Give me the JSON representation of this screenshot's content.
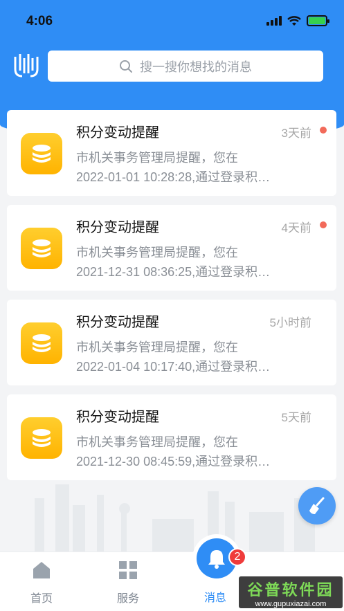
{
  "status_bar": {
    "time": "4:06"
  },
  "search": {
    "placeholder": "搜一搜你想找的消息"
  },
  "messages": [
    {
      "title": "积分变动提醒",
      "time": "3天前",
      "unread": true,
      "line1": "市机关事务管理局提醒，您在",
      "line2": "2022-01-01 10:28:28,通过登录积…"
    },
    {
      "title": "积分变动提醒",
      "time": "4天前",
      "unread": true,
      "line1": "市机关事务管理局提醒，您在",
      "line2": "2021-12-31 08:36:25,通过登录积…"
    },
    {
      "title": "积分变动提醒",
      "time": "5小时前",
      "unread": false,
      "line1": "市机关事务管理局提醒，您在",
      "line2": "2022-01-04 10:17:40,通过登录积…"
    },
    {
      "title": "积分变动提醒",
      "time": "5天前",
      "unread": false,
      "line1": "市机关事务管理局提醒，您在",
      "line2": "2021-12-30 08:45:59,通过登录积…"
    }
  ],
  "tabbar": {
    "tabs": [
      {
        "label": "首页",
        "icon": "home-icon"
      },
      {
        "label": "服务",
        "icon": "grid-icon"
      },
      {
        "label": "消息",
        "icon": "bell-icon",
        "badge": "2",
        "active": true
      }
    ]
  },
  "watermark": {
    "main": "谷普软件园",
    "sub": "www.gupuxiazai.com"
  },
  "colors": {
    "primary": "#2f8df5",
    "unread_dot": "#f26a5a",
    "coin_icon": "#ffb300",
    "badge": "#ef3b3b"
  }
}
